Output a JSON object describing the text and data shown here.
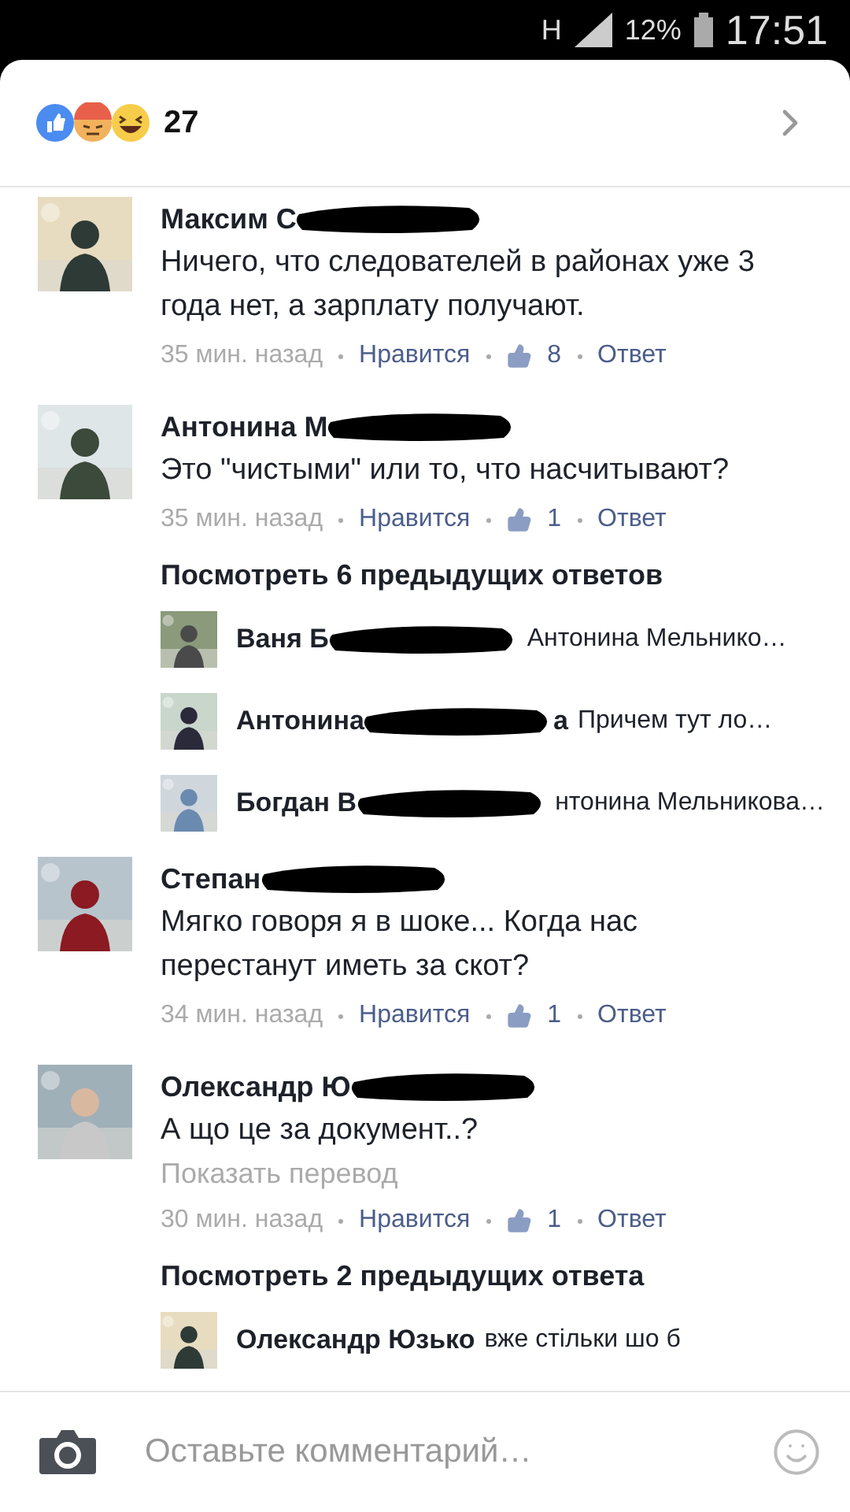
{
  "status_bar": {
    "network": "H",
    "battery": "12%",
    "time": "17:51"
  },
  "reactions": {
    "count": "27"
  },
  "thread": [
    {
      "kind": "comment",
      "author": "Максим С",
      "body": "Ничего, что следователей в районах уже 3 года нет, а зарплату получают.",
      "time": "35 мин. назад",
      "like": "Нравится",
      "likes": "8",
      "reply": "Ответ"
    },
    {
      "kind": "comment",
      "author": "Антонина М",
      "body": "Это \"чистыми\" или то, что насчитывают?",
      "time": "35 мин. назад",
      "like": "Нравится",
      "likes": "1",
      "reply": "Ответ"
    },
    {
      "kind": "more",
      "label": "Посмотреть 6 предыдущих ответов"
    },
    {
      "kind": "reply",
      "author": "Ваня Б",
      "redacted": true,
      "text": "Антонина Мельнико…"
    },
    {
      "kind": "reply",
      "author": "Антонина",
      "redacted": true,
      "tail": "а",
      "text": "Причем тут ло…"
    },
    {
      "kind": "reply",
      "author": "Богдан В",
      "redacted": true,
      "text": "нтонина Мельникова…"
    },
    {
      "kind": "comment",
      "author": "Степан",
      "body": "Мягко говоря я в шоке... Когда нас перестанут иметь за скот?",
      "time": "34 мин. назад",
      "like": "Нравится",
      "likes": "1",
      "reply": "Ответ"
    },
    {
      "kind": "comment",
      "author": "Олександр Ю",
      "body": "А що це за документ..?",
      "translate": "Показать перевод",
      "time": "30 мин. назад",
      "like": "Нравится",
      "likes": "1",
      "reply": "Ответ"
    },
    {
      "kind": "more",
      "label": "Посмотреть 2 предыдущих ответа"
    },
    {
      "kind": "reply",
      "author": "Олександр Юзько",
      "text": "вже стільки шо б"
    }
  ],
  "composer": {
    "placeholder": "Оставьте комментарий…"
  }
}
